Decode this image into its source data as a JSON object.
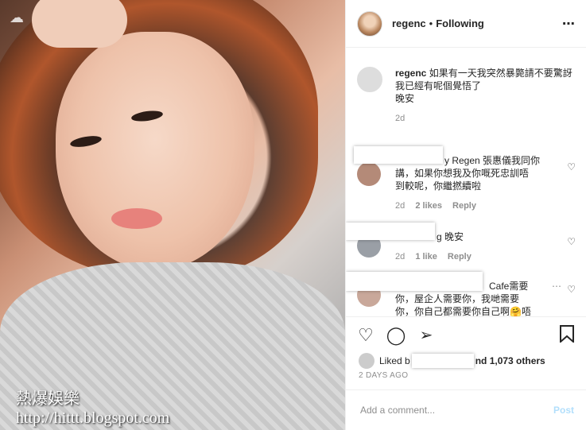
{
  "post": {
    "watermark_line1": "熱爆娛樂",
    "watermark_line2": "http://hittt.blogspot.com"
  },
  "header": {
    "username": "regenc",
    "separator": "•",
    "follow_status": "Following",
    "more_icon": "⋯"
  },
  "caption": {
    "username": "regenc",
    "lines": [
      "如果有一天我突然暴斃請不要驚訝",
      "我已經有呢個覺悟了",
      "晚安"
    ],
    "time": "2d"
  },
  "comments": [
    {
      "text_line1": "y Regen 張惠儀我同你",
      "text_line2": "講，如果你想我及你嘅死忠訓唔",
      "text_line3": "到較呢，你繼撚續啦",
      "time": "2d",
      "likes": "2 likes",
      "reply": "Reply"
    },
    {
      "text_line1": "g 晚安",
      "time": "2d",
      "likes": "1 like",
      "reply": "Reply"
    },
    {
      "text_line1": "Cafe需要",
      "text_line2": "你，屋企人需要你，我哋需要",
      "text_line3": "你，你自己都需要你自己啊🤗唔"
    }
  ],
  "actions": {
    "like_icon": "heart-outline",
    "comment_icon": "speech-bubble",
    "share_icon": "paper-plane",
    "save_icon": "bookmark"
  },
  "likes": {
    "prefix": "Liked b",
    "suffix": "nd 1,073 others"
  },
  "timestamp": "2 DAYS AGO",
  "add_comment": {
    "placeholder": "Add a comment...",
    "post_label": "Post"
  },
  "colors": {
    "post_button": "#b2dffc",
    "meta_text": "#8e8e8e"
  }
}
